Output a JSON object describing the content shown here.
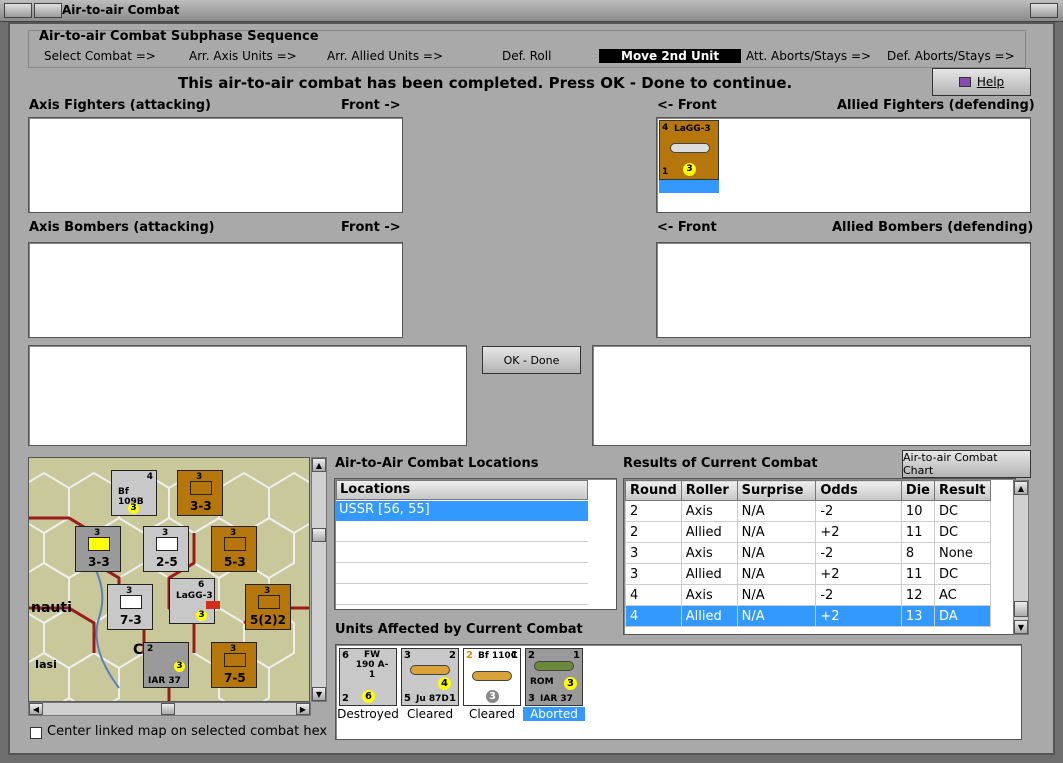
{
  "window": {
    "title": "Air-to-air Combat"
  },
  "sequence": {
    "title": "Air-to-air Combat Subphase Sequence",
    "steps": [
      "Select Combat =>",
      "Arr. Axis Units =>",
      "Arr. Allied Units =>",
      "Def. Roll",
      "Move 2nd Unit",
      "Att. Aborts/Stays =>",
      "Def. Aborts/Stays =>"
    ],
    "active_index": 4
  },
  "status_message": "This air-to-air combat has been completed.  Press OK - Done to continue.",
  "help_button": "Help",
  "panels": {
    "axis_fighters": "Axis Fighters (attacking)",
    "allied_fighters": "Allied Fighters (defending)",
    "axis_bombers": "Axis Bombers (attacking)",
    "allied_bombers": "Allied Bombers (defending)",
    "front_right": "Front ->",
    "front_left": "<- Front"
  },
  "allied_fighter_unit": {
    "strength": "4",
    "name": "LaGG-3",
    "bottom": "1",
    "range": "3",
    "selected": true
  },
  "ok_button": "OK - Done",
  "locations": {
    "title": "Air-to-Air Combat Locations",
    "header": "Locations",
    "items": [
      "USSR [56, 55]"
    ]
  },
  "results": {
    "title": "Results of Current Combat",
    "chart_button": "Air-to-air Combat Chart",
    "columns": [
      "Round",
      "Roller",
      "Surprise",
      "Odds",
      "Die",
      "Result"
    ],
    "rows": [
      [
        "2",
        "Axis",
        "N/A",
        "-2",
        "10",
        "DC"
      ],
      [
        "2",
        "Allied",
        "N/A",
        "+2",
        "11",
        "DC"
      ],
      [
        "3",
        "Axis",
        "N/A",
        "-2",
        "8",
        "None"
      ],
      [
        "3",
        "Allied",
        "N/A",
        "+2",
        "11",
        "DC"
      ],
      [
        "4",
        "Axis",
        "N/A",
        "-2",
        "12",
        "AC"
      ],
      [
        "4",
        "Allied",
        "N/A",
        "+2",
        "13",
        "DA"
      ]
    ],
    "selected_row": 5
  },
  "affected": {
    "title": "Units Affected by Current Combat",
    "units": [
      {
        "top_left": "6",
        "name": "FW 190 A-1",
        "bottom_left": "2",
        "value": "6",
        "label": "Destroyed",
        "color": "#c8c8c8"
      },
      {
        "top_left": "3",
        "name": "Ju 87D",
        "bottom_left": "5",
        "top_right": "2",
        "bottom_right": "1",
        "value": "4",
        "label": "Cleared",
        "color": "#c8c8c8"
      },
      {
        "top_left": "2",
        "name": "Bf 110C",
        "top_right": "1",
        "value": "3",
        "label": "Cleared",
        "color": "#ffffff"
      },
      {
        "top_left": "2",
        "name": "IAR 37",
        "sub": "ROM",
        "bottom_left": "3",
        "top_right": "1",
        "value": "3",
        "label": "Aborted",
        "color": "#9a9a9a",
        "selected": true
      }
    ]
  },
  "map": {
    "place_labels": [
      "nauti",
      "Iasi",
      "C"
    ],
    "units": [
      {
        "text": "Bf 109B",
        "top": "4",
        "value": "3",
        "color": "#c8c8c8"
      },
      {
        "text": "3-3",
        "top": "3",
        "color": "#b5770c"
      },
      {
        "text": "3-3",
        "top": "3",
        "color": "#9a9a9a"
      },
      {
        "text": "2-5",
        "top": "3",
        "color": "#c8c8c8"
      },
      {
        "text": "5-3",
        "top": "3",
        "color": "#b5770c"
      },
      {
        "text": "7-3",
        "top": "3",
        "color": "#c8c8c8"
      },
      {
        "text": "LaGG-3",
        "top": "6",
        "value": "3",
        "color": "#c8c8c8"
      },
      {
        "text": "5(2)2",
        "top": "3",
        "color": "#b5770c"
      },
      {
        "text": "IAR 37",
        "top": "2",
        "value": "3",
        "color": "#9a9a9a"
      },
      {
        "text": "7-5",
        "top": "3",
        "color": "#b5770c"
      }
    ]
  },
  "center_checkbox": "Center linked map on selected combat hex"
}
